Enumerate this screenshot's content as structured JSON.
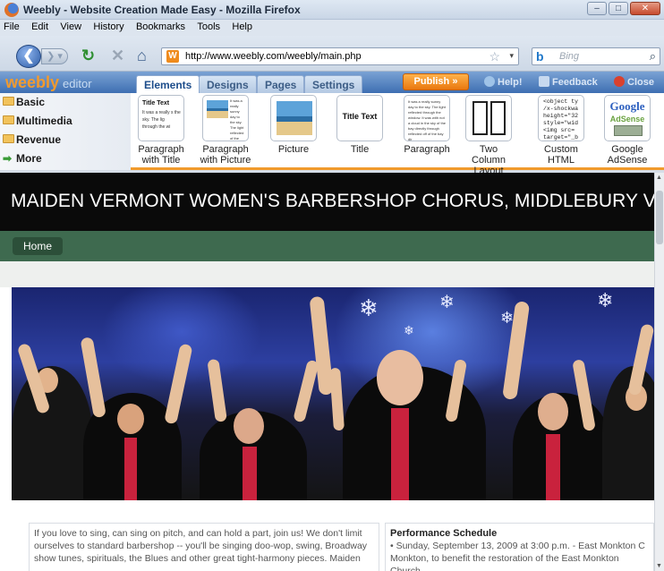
{
  "window": {
    "title": "Weebly - Website Creation Made Easy - Mozilla Firefox",
    "buttons": {
      "minimize": "–",
      "maximize": "□",
      "close": "✕"
    }
  },
  "menu": [
    "File",
    "Edit",
    "View",
    "History",
    "Bookmarks",
    "Tools",
    "Help"
  ],
  "navigation": {
    "url": "http://www.weebly.com/weebly/main.php",
    "search_placeholder": "Bing",
    "search_engine_icon": "b",
    "site_icon": "W"
  },
  "editor": {
    "logo": "weebly",
    "logo_suffix": "editor",
    "tabs": [
      "Elements",
      "Designs",
      "Pages",
      "Settings"
    ],
    "active_tab": "Elements",
    "publish_label": "Publish »",
    "help_label": "Help!",
    "feedback_label": "Feedback",
    "close_label": "Close"
  },
  "palette": {
    "categories": [
      "Basic",
      "Multimedia",
      "Revenue",
      "More"
    ],
    "widgets": [
      {
        "label": "Paragraph with Title",
        "thumb_title": "Title Text",
        "thumb_text": "It was a really s the sky. The lig through the wi"
      },
      {
        "label": "Paragraph with Picture",
        "thumb_text": "It was a really sunny day to the sky. The light reflected of the bay directly through reflected off of the bay dir"
      },
      {
        "label": "Picture"
      },
      {
        "label": "Title",
        "thumb_title": "Title Text"
      },
      {
        "label": "Paragraph",
        "thumb_text": "It was a really sunny day to the sky. The light reflected through the window. It was with not a cloud in the sky of the bay directly through reflected off of the bay dir"
      },
      {
        "label": "Two Column Layout"
      },
      {
        "label": "Custom HTML",
        "thumb_code": "<object ty\n/x-shockwa\nheight=\"32\nstyle=\"wid\n<img src=\ntarget=\"_b"
      },
      {
        "label": "Google AdSense",
        "thumb_title": "Google",
        "thumb_sub": "AdSense"
      }
    ]
  },
  "site": {
    "title": "MAIDEN VERMONT WOMEN'S BARBERSHOP CHORUS, MIDDLEBURY VT",
    "nav": [
      "Home"
    ],
    "intro_text": "If you love to sing, can sing on pitch, and can hold a part, join us! We don't limit ourselves to standard barbershop -- you'll be singing doo-wop, swing, Broadway show tunes, spirituals, the Blues and other great tight-harmony pieces. Maiden",
    "schedule_title": "Performance Schedule",
    "schedule_item": "•  Sunday, September 13, 2009 at 3:00 p.m. - East Monkton C Monkton, to benefit the restoration of the East Monkton Church"
  },
  "colors": {
    "accent_orange": "#f09a2c",
    "weebly_blue": "#3e6fb2",
    "site_nav_green": "#3e6a4f"
  }
}
